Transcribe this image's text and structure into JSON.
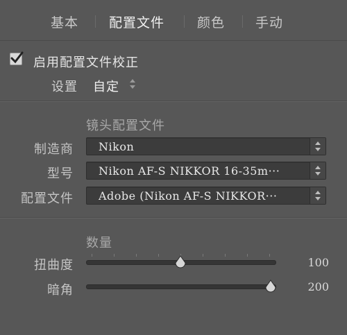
{
  "tabs": [
    {
      "label": "基本",
      "active": false
    },
    {
      "label": "配置文件",
      "active": true
    },
    {
      "label": "颜色",
      "active": false
    },
    {
      "label": "手动",
      "active": false
    }
  ],
  "enable_profile": {
    "label": "启用配置文件校正",
    "checked": true
  },
  "setup": {
    "label": "设置",
    "value": "自定"
  },
  "lens_profile": {
    "section_title": "镜头配置文件",
    "make": {
      "label": "制造商",
      "value": "Nikon"
    },
    "model": {
      "label": "型号",
      "value": "Nikon AF-S NIKKOR 16-35m···"
    },
    "profile": {
      "label": "配置文件",
      "value": "Adobe (Nikon AF-S NIKKOR···"
    }
  },
  "amount": {
    "section_title": "数量",
    "distortion": {
      "label": "扭曲度",
      "value": "100",
      "level": 0.5
    },
    "vignetting": {
      "label": "暗角",
      "value": "200",
      "level": 1.0
    }
  },
  "colors": {
    "panel_bg": "#575757",
    "field_bg": "#3c3c3c",
    "text_bright": "#f0f0f0"
  }
}
